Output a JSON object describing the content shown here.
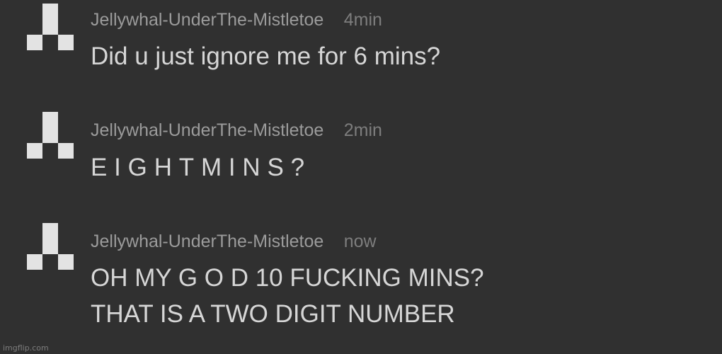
{
  "comments": [
    {
      "username": "Jellywhal-UnderThe-Mistletoe",
      "time": "4min",
      "lines": [
        "Did u just ignore me for 6 mins?"
      ]
    },
    {
      "username": "Jellywhal-UnderThe-Mistletoe",
      "time": "2min",
      "lines": [
        "EIGHTMINS?"
      ]
    },
    {
      "username": "Jellywhal-UnderThe-Mistletoe",
      "time": "now",
      "lines": [
        "OH MY G O D 10 FUCKING MINS?",
        "THAT IS A TWO DIGIT NUMBER"
      ]
    }
  ],
  "watermark": "imgflip.com",
  "colors": {
    "background": "#303030",
    "avatar": "#e3e3e3",
    "username": "#9b9b9b",
    "time": "#7d7d7d",
    "text": "#d6d6d6"
  }
}
